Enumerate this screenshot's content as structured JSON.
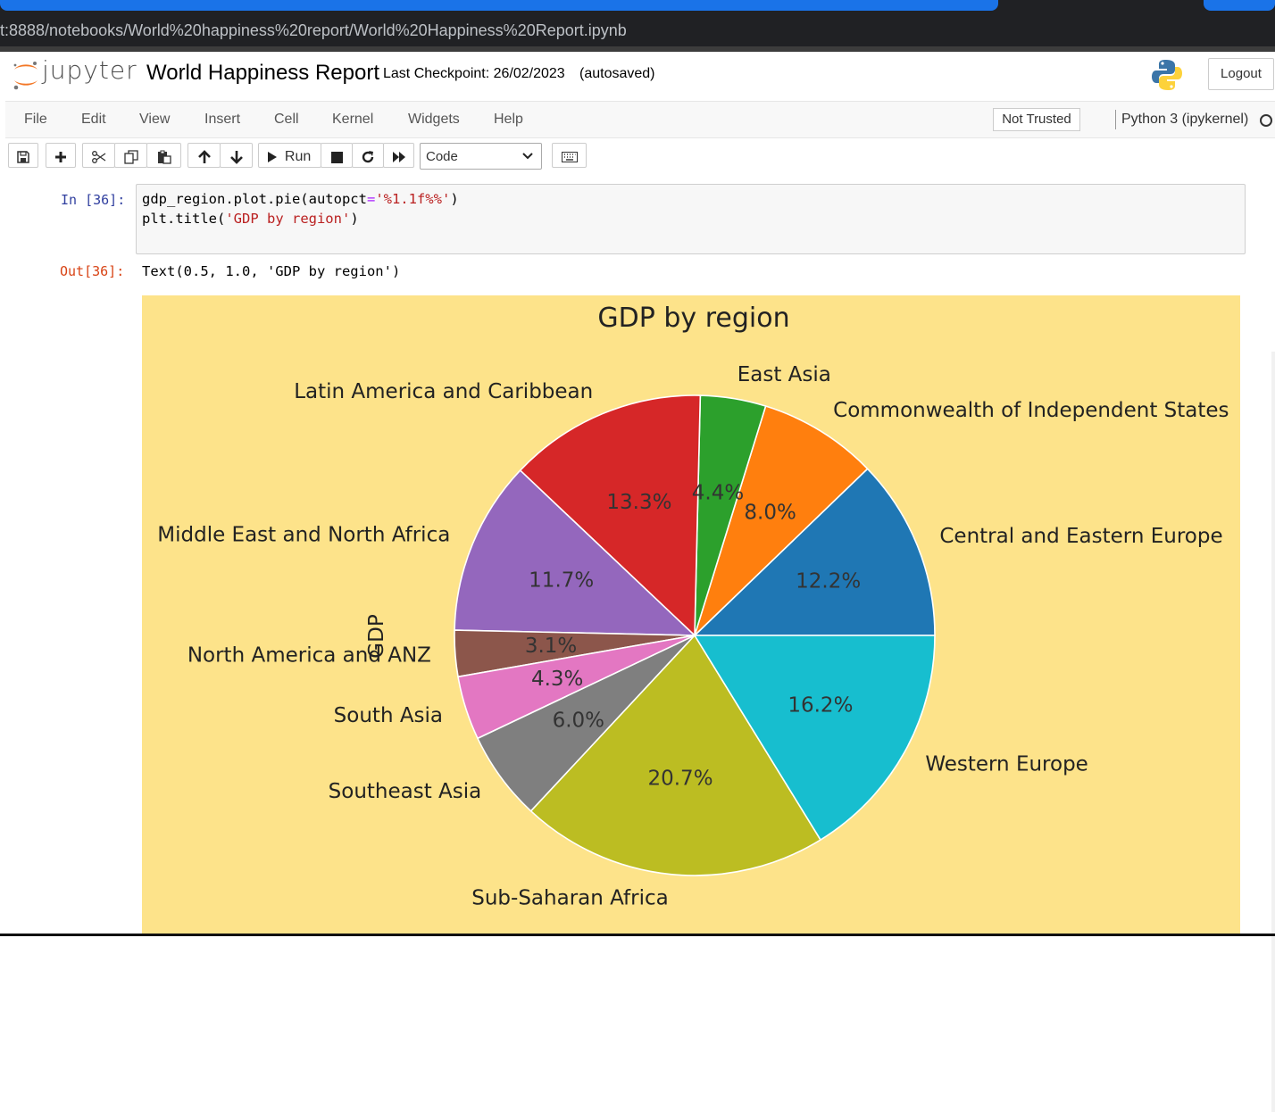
{
  "browser": {
    "url": "t:8888/notebooks/World%20happiness%20report/World%20Happiness%20Report.ipynb"
  },
  "header": {
    "logo_text": "jupyter",
    "notebook_name": "World Happiness Report",
    "checkpoint": "Last Checkpoint: 26/02/2023",
    "autosave": "(autosaved)",
    "logout": "Logout"
  },
  "menubar": {
    "items": [
      "File",
      "Edit",
      "View",
      "Insert",
      "Cell",
      "Kernel",
      "Widgets",
      "Help"
    ],
    "trust_status": "Not Trusted",
    "kernel": "Python 3 (ipykernel)"
  },
  "toolbar": {
    "run_label": "Run",
    "cell_type": "Code",
    "icons": [
      "save-icon",
      "plus-icon",
      "scissors-icon",
      "copy-icon",
      "paste-icon",
      "arrow-up-icon",
      "arrow-down-icon",
      "play-icon",
      "stop-icon",
      "restart-icon",
      "fast-forward-icon",
      "keyboard-icon"
    ]
  },
  "cell": {
    "in_prompt": "In [36]:",
    "line1_a": "gdp_region.plot.pie(autopct",
    "line1_op": "=",
    "line1_str": "'%1.1f%%'",
    "line1_end": ")",
    "line2_a": "plt.title(",
    "line2_str": "'GDP by region'",
    "line2_end": ")",
    "out_prompt": "Out[36]:",
    "out_text": "Text(0.5, 1.0, 'GDP by region')"
  },
  "chart_data": {
    "type": "pie",
    "title": "GDP by region",
    "ylabel": "GDP",
    "background": "#fde38a",
    "startangle": 0,
    "slices": [
      {
        "label": "Central and Eastern Europe",
        "value": 12.2,
        "pct": "12.2%",
        "color": "#1f77b4"
      },
      {
        "label": "Commonwealth of Independent States",
        "value": 8.0,
        "pct": "8.0%",
        "color": "#ff7f0e"
      },
      {
        "label": "East Asia",
        "value": 4.4,
        "pct": "4.4%",
        "color": "#2ca02c"
      },
      {
        "label": "Latin America and Caribbean",
        "value": 13.3,
        "pct": "13.3%",
        "color": "#d62728"
      },
      {
        "label": "Middle East and North Africa",
        "value": 11.7,
        "pct": "11.7%",
        "color": "#9467bd"
      },
      {
        "label": "North America and ANZ",
        "value": 3.1,
        "pct": "3.1%",
        "color": "#8c564b"
      },
      {
        "label": "South Asia",
        "value": 4.3,
        "pct": "4.3%",
        "color": "#e377c2"
      },
      {
        "label": "Southeast Asia",
        "value": 6.0,
        "pct": "6.0%",
        "color": "#7f7f7f"
      },
      {
        "label": "Sub-Saharan Africa",
        "value": 20.7,
        "pct": "20.7%",
        "color": "#bcbd22"
      },
      {
        "label": "Western Europe",
        "value": 16.2,
        "pct": "16.2%",
        "color": "#17becf"
      }
    ]
  }
}
